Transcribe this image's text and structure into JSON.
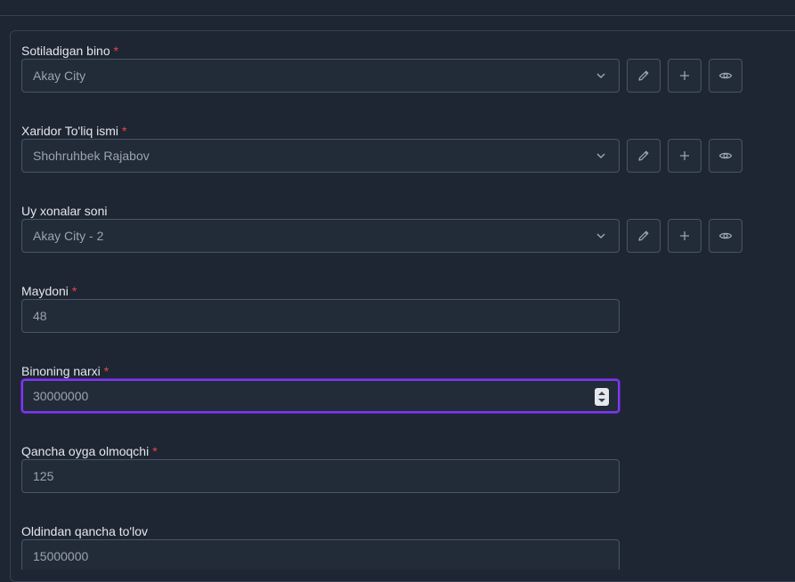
{
  "form": {
    "fields": [
      {
        "label": "Sotiladigan bino",
        "required_mark": "*",
        "value": "Akay City"
      },
      {
        "label": "Xaridor To'liq ismi",
        "required_mark": "*",
        "value": "Shohruhbek Rajabov"
      },
      {
        "label": "Uy xonalar soni",
        "value": "Akay City - 2"
      },
      {
        "label": "Maydoni",
        "required_mark": "*",
        "value": "48"
      },
      {
        "label": "Binoning narxi",
        "required_mark": "*",
        "value": "30000000"
      },
      {
        "label": "Qancha oyga olmoqchi",
        "required_mark": "*",
        "value": "125"
      },
      {
        "label": "Oldindan qancha to'lov",
        "value": "15000000"
      }
    ]
  },
  "icons": {
    "edit": "pencil-icon",
    "add": "plus-icon",
    "view": "eye-icon",
    "dropdown": "chevron-down-icon"
  },
  "colors": {
    "background": "#1e2633",
    "required": "#ef4444",
    "focus": "#7c3aed"
  }
}
